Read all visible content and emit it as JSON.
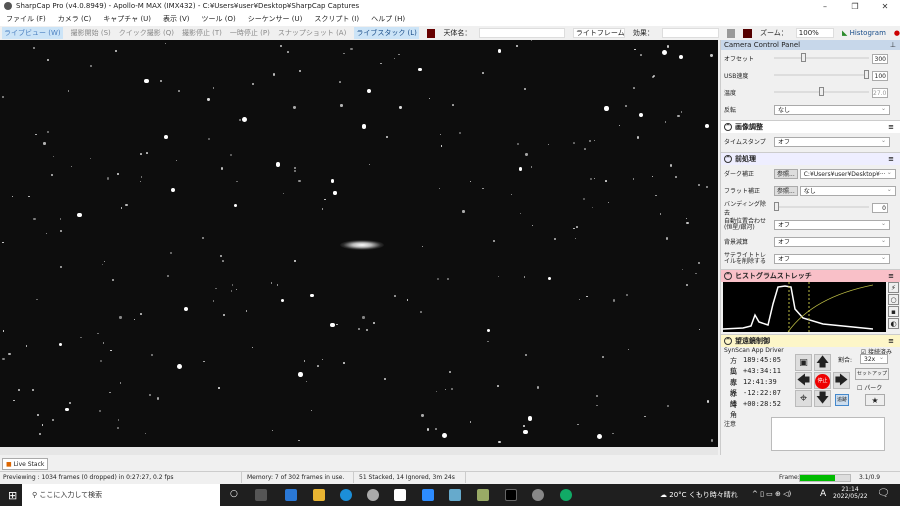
{
  "window": {
    "title": "SharpCap Pro (v4.0.8949) - Apollo-M MAX (IMX432) - C:¥Users¥user¥Desktop¥SharpCap Captures"
  },
  "menu": [
    "ファイル (F)",
    "カメラ (C)",
    "キャプチャ (U)",
    "表示 (V)",
    "ツール (O)",
    "シーケンサー (U)",
    "スクリプト (I)",
    "ヘルプ (H)"
  ],
  "toolbar": {
    "live_view": "ライブビュー (W)",
    "start_capture": "撮影開始 (S)",
    "quick_capture": "クイック撮影 (Q)",
    "stop_capture": "撮影停止 (T)",
    "pause": "一時停止 (P)",
    "snapshot": "スナップショット (A)",
    "live_stack": "ライブスタック (L)",
    "target_label": "天体名：",
    "target_value": "",
    "frame_type": "ライトフレーム",
    "effect_label": "効果：",
    "effect_value": "",
    "zoom_label": "ズーム：",
    "zoom_value": "100%",
    "histogram": "Histogram"
  },
  "panel": {
    "title": "Camera Control Panel",
    "offset": {
      "label": "オフセット",
      "value": "300",
      "fraction": 0.3
    },
    "usb": {
      "label": "USB速度",
      "value": "100",
      "fraction": 1.0
    },
    "temp": {
      "label": "温度",
      "value": "27.0",
      "fraction": 0.5
    },
    "flip": {
      "label": "反転",
      "value": "なし"
    },
    "image_adjust": {
      "title": "画像調整",
      "timestamp_label": "タイムスタンプ",
      "timestamp_value": "オフ"
    },
    "preprocess": {
      "title": "前処理",
      "dark_label": "ダーク補正",
      "dark_button": "参照...",
      "dark_value": "C:¥Users¥user¥Desktop¥···",
      "flat_label": "フラット補正",
      "flat_button": "参照...",
      "flat_value": "なし",
      "banding_label": "バンディング除去",
      "banding_value": "0",
      "align_label": "自動位置合わせ (恒星/銀河)",
      "align_value": "オフ",
      "bg_label": "背景減算",
      "bg_value": "オフ",
      "sat_label": "サテライトトレイルを削除する",
      "sat_value": "オフ"
    },
    "histogram": {
      "title": "ヒストグラムストレッチ"
    },
    "telescope": {
      "title": "望遠鏡制御",
      "driver": "SynScan App Driver",
      "connected_label": "接続済み",
      "connected": true,
      "coords": [
        {
          "k": "方位",
          "v": "189:45:05"
        },
        {
          "k": "高度",
          "v": "+43:34:11"
        },
        {
          "k": "赤経",
          "v": "12:41:39"
        },
        {
          "k": "赤緯",
          "v": "-12:22:07"
        },
        {
          "k": "時角",
          "v": "+00:28:52"
        }
      ],
      "stop": "停止",
      "rate_label": "割合:",
      "rate_value": "32x",
      "setup": "セットアップ",
      "park_label": "パーク",
      "park": false,
      "track": "追跡"
    },
    "notes": {
      "label": "注意",
      "value": ""
    }
  },
  "livestack_tab": "Live Stack",
  "status": {
    "preview": "Previewing : 1034 frames (0 dropped) in 0:27:27, 0.2 fps",
    "memory": "Memory: 7 of 302 frames in use.",
    "stacked": "51 Stacked, 14 Ignored, 3m 24s",
    "frame_label": "Frame:",
    "frame_progress": 0.7,
    "frame_value": "3.1/0.9"
  },
  "taskbar": {
    "search_placeholder": "ここに入力して検索",
    "weather": "20°C くもり時々晴れ",
    "ime": "A",
    "time": "21:14",
    "date": "2022/05/22"
  }
}
